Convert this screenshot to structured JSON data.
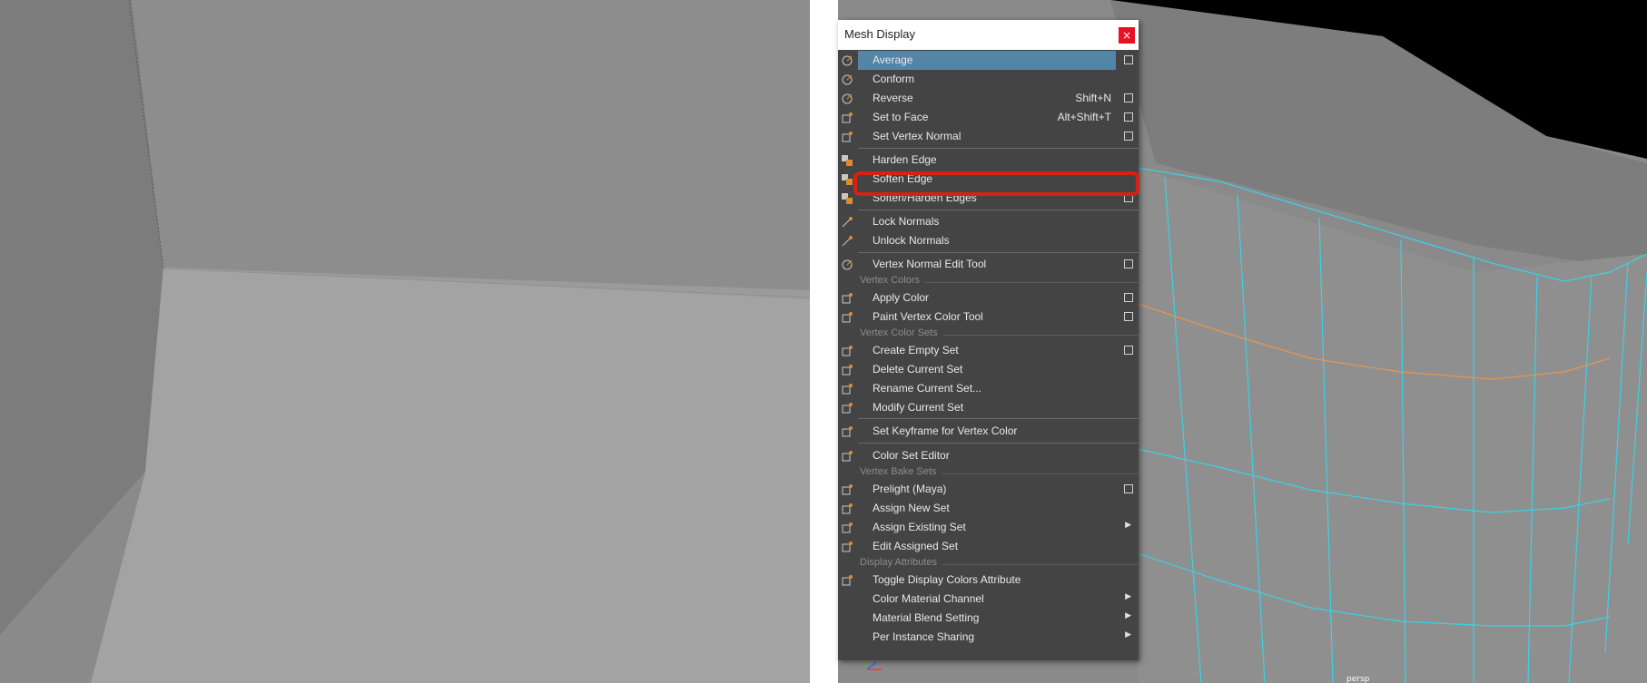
{
  "window": {
    "title": "Mesh Display",
    "close_label": "×"
  },
  "viewport": {
    "camera_label": "persp"
  },
  "menu": {
    "items": [
      {
        "label": "Average",
        "shortcut": "",
        "option_box": true,
        "submenu": false,
        "active": true,
        "icon": "average-normals-icon"
      },
      {
        "label": "Conform",
        "shortcut": "",
        "option_box": false,
        "submenu": false,
        "icon": "conform-normals-icon"
      },
      {
        "label": "Reverse",
        "shortcut": "Shift+N",
        "option_box": true,
        "submenu": false,
        "icon": "reverse-normals-icon"
      },
      {
        "label": "Set to Face",
        "shortcut": "Alt+Shift+T",
        "option_box": true,
        "submenu": false,
        "icon": "set-to-face-icon"
      },
      {
        "label": "Set Vertex Normal",
        "shortcut": "",
        "option_box": true,
        "submenu": false,
        "icon": "set-vertex-normal-icon"
      },
      {
        "label": "Harden Edge",
        "shortcut": "",
        "option_box": false,
        "submenu": false,
        "icon": "harden-edge-icon"
      },
      {
        "label": "Soften Edge",
        "shortcut": "",
        "option_box": false,
        "submenu": false,
        "icon": "soften-edge-icon"
      },
      {
        "label": "Soften/Harden Edges",
        "shortcut": "",
        "option_box": true,
        "submenu": false,
        "icon": "soften-harden-edges-icon"
      },
      {
        "label": "Lock Normals",
        "shortcut": "",
        "option_box": false,
        "submenu": false,
        "icon": "lock-normals-icon"
      },
      {
        "label": "Unlock Normals",
        "shortcut": "",
        "option_box": false,
        "submenu": false,
        "icon": "unlock-normals-icon"
      },
      {
        "label": "Vertex Normal Edit Tool",
        "shortcut": "",
        "option_box": true,
        "submenu": false,
        "icon": "vertex-normal-edit-tool-icon"
      },
      {
        "label": "Apply Color",
        "shortcut": "",
        "option_box": true,
        "submenu": false,
        "icon": "apply-color-icon"
      },
      {
        "label": "Paint Vertex Color Tool",
        "shortcut": "",
        "option_box": true,
        "submenu": false,
        "icon": "paint-vertex-color-icon"
      },
      {
        "label": "Create Empty Set",
        "shortcut": "",
        "option_box": true,
        "submenu": false,
        "icon": "create-empty-set-icon"
      },
      {
        "label": "Delete Current Set",
        "shortcut": "",
        "option_box": false,
        "submenu": false,
        "icon": "delete-current-set-icon"
      },
      {
        "label": "Rename Current Set...",
        "shortcut": "",
        "option_box": false,
        "submenu": false,
        "icon": "rename-current-set-icon"
      },
      {
        "label": "Modify Current Set",
        "shortcut": "",
        "option_box": false,
        "submenu": false,
        "icon": "modify-current-set-icon"
      },
      {
        "label": "Set Keyframe for Vertex Color",
        "shortcut": "",
        "option_box": false,
        "submenu": false,
        "icon": "set-keyframe-vertex-color-icon"
      },
      {
        "label": "Color Set Editor",
        "shortcut": "",
        "option_box": false,
        "submenu": false,
        "icon": "color-set-editor-icon"
      },
      {
        "label": "Prelight (Maya)",
        "shortcut": "",
        "option_box": true,
        "submenu": false,
        "icon": "prelight-icon"
      },
      {
        "label": "Assign New Set",
        "shortcut": "",
        "option_box": false,
        "submenu": false,
        "icon": "assign-new-set-icon"
      },
      {
        "label": "Assign Existing Set",
        "shortcut": "",
        "option_box": false,
        "submenu": true,
        "icon": "assign-existing-set-icon"
      },
      {
        "label": "Edit Assigned Set",
        "shortcut": "",
        "option_box": false,
        "submenu": false,
        "icon": "edit-assigned-set-icon"
      },
      {
        "label": "Toggle Display Colors Attribute",
        "shortcut": "",
        "option_box": false,
        "submenu": false,
        "icon": "toggle-display-colors-icon"
      },
      {
        "label": "Color Material Channel",
        "shortcut": "",
        "option_box": false,
        "submenu": true,
        "icon": ""
      },
      {
        "label": "Material Blend Setting",
        "shortcut": "",
        "option_box": false,
        "submenu": true,
        "icon": ""
      },
      {
        "label": "Per Instance Sharing",
        "shortcut": "",
        "option_box": false,
        "submenu": true,
        "icon": ""
      }
    ],
    "sections": {
      "vertex_colors": "Vertex Colors",
      "vertex_color_sets": "Vertex Color Sets",
      "vertex_bake_sets": "Vertex Bake Sets",
      "display_attributes": "Display Attributes"
    }
  },
  "colors": {
    "menu_bg": "#444444",
    "highlight": "#5285a6",
    "annotation": "#d32312",
    "wireframe": "#39d3e6",
    "selected_edge": "#e8964f"
  }
}
